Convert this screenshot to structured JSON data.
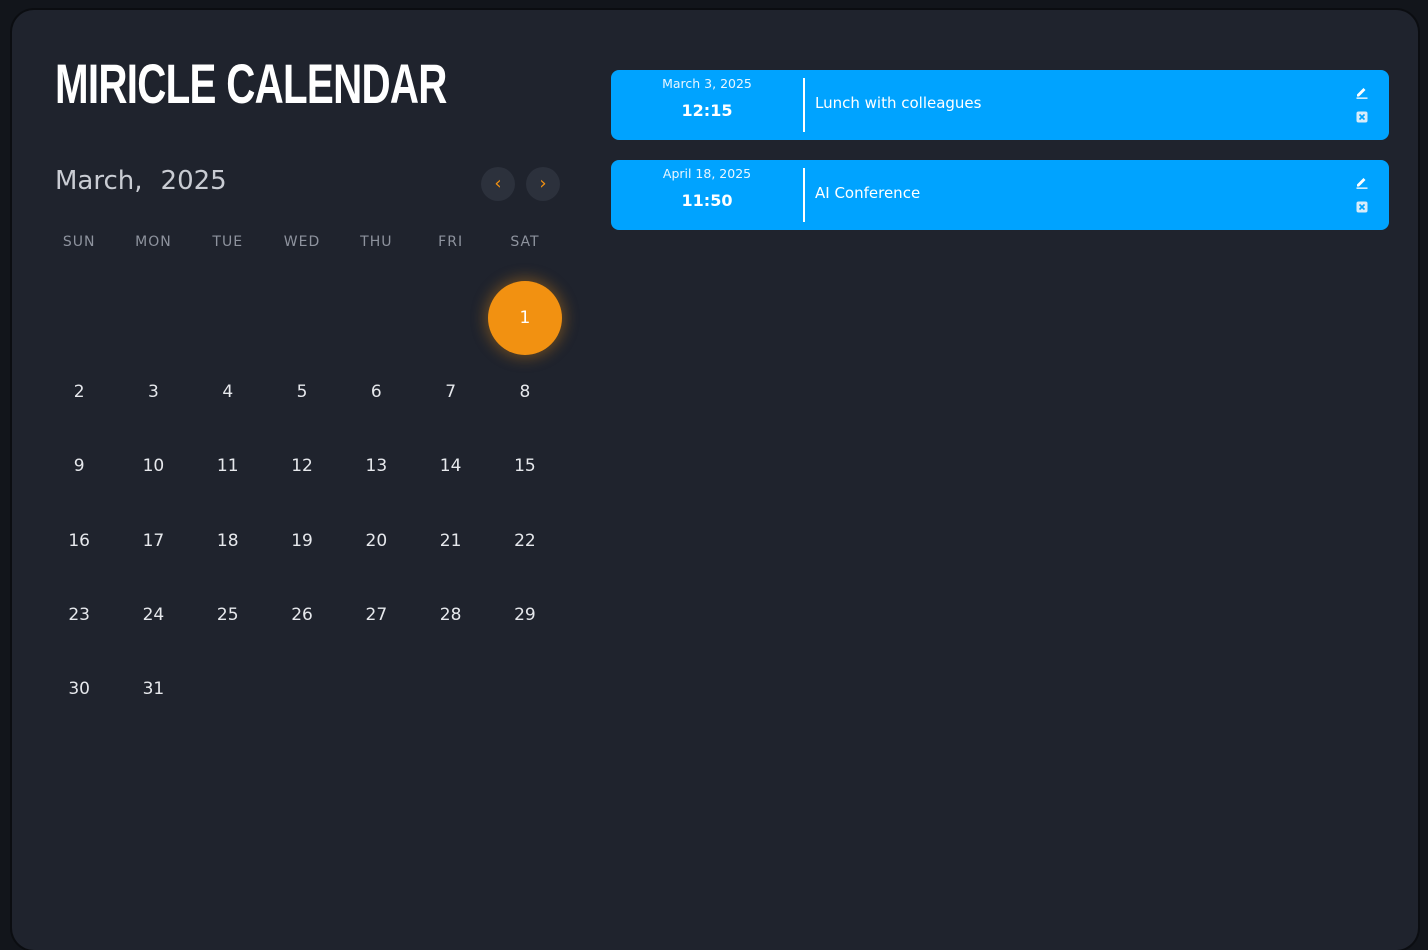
{
  "app": {
    "title": "MIRICLE CALENDAR"
  },
  "calendar": {
    "month": "March,",
    "year": "2025",
    "prev_icon": "chevron-left-icon",
    "next_icon": "chevron-right-icon",
    "weekdays": [
      "SUN",
      "MON",
      "TUE",
      "WED",
      "THU",
      "FRI",
      "SAT"
    ],
    "leading_blanks": 6,
    "days_in_month": 31,
    "selected_day": "1",
    "accent_color": "#f29111"
  },
  "events": [
    {
      "date": "March 3, 2025",
      "time": "12:15",
      "title": "Lunch with colleagues",
      "edit_icon": "edit-icon",
      "delete_icon": "delete-icon"
    },
    {
      "date": "April 18, 2025",
      "time": "11:50",
      "title": "AI Conference",
      "edit_icon": "edit-icon",
      "delete_icon": "delete-icon"
    }
  ],
  "colors": {
    "background": "#1f232d",
    "event_card": "#00a3ff",
    "selected_day": "#f29111"
  }
}
